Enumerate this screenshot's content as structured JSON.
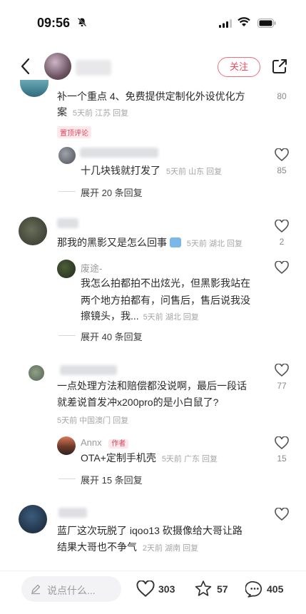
{
  "status": {
    "time": "09:56"
  },
  "header": {
    "follow_label": "关注"
  },
  "comments": [
    {
      "text_line1": "补一个重点 4、免费提供定制化外设优化方",
      "text_line2": "案",
      "meta": "5天前 江苏 回复",
      "badge": "置顶评论",
      "likes": "80",
      "replies": [
        {
          "text": "十几块钱就打发了",
          "meta": "5天前 山东 回复",
          "likes": "85"
        }
      ],
      "expand_label": "展开 20 条回复"
    },
    {
      "text": "那我的黑影又是怎么回事",
      "meta": "5天前 湖北 回复",
      "likes": "2",
      "replies": [
        {
          "name": "废途-",
          "text_line1": "我怎么拍都拍不出炫光，但黑影我站在",
          "text_line2": "两个地方拍都有，问售后，售后说我没",
          "text_line3": "擦镜头，我...",
          "meta": "5天前 湖北 回复"
        }
      ],
      "expand_label": "展开 40 条回复"
    },
    {
      "text_line1": "一点处理方法和赔偿都没说啊，最后一段话",
      "text_line2": "就差说首发冲x200pro的是小白鼠了?",
      "meta": "5天前 中国澳门 回复",
      "likes": "77",
      "replies": [
        {
          "name": "Annx",
          "author_badge": "作者",
          "text": "OTA+定制手机壳",
          "meta": "5天前 广东 回复",
          "likes": "15"
        }
      ],
      "expand_label": "展开 15 条回复"
    },
    {
      "text_line1": "蓝厂这次玩脱了 iqoo13 砍摄像给大哥让路",
      "text_line2": "结果大哥也不争气",
      "meta": "2天前 湖南 回复"
    }
  ],
  "bottom_bar": {
    "placeholder": "说点什么...",
    "likes": "303",
    "stars": "57",
    "comments": "405"
  },
  "icons": [
    "bell-slash-icon",
    "signal-icon",
    "wifi-icon",
    "battery-icon",
    "back-icon",
    "share-icon",
    "heart-icon",
    "star-icon",
    "chat-icon",
    "pencil-icon"
  ],
  "colors": {
    "accent": "#ef4a5e"
  }
}
